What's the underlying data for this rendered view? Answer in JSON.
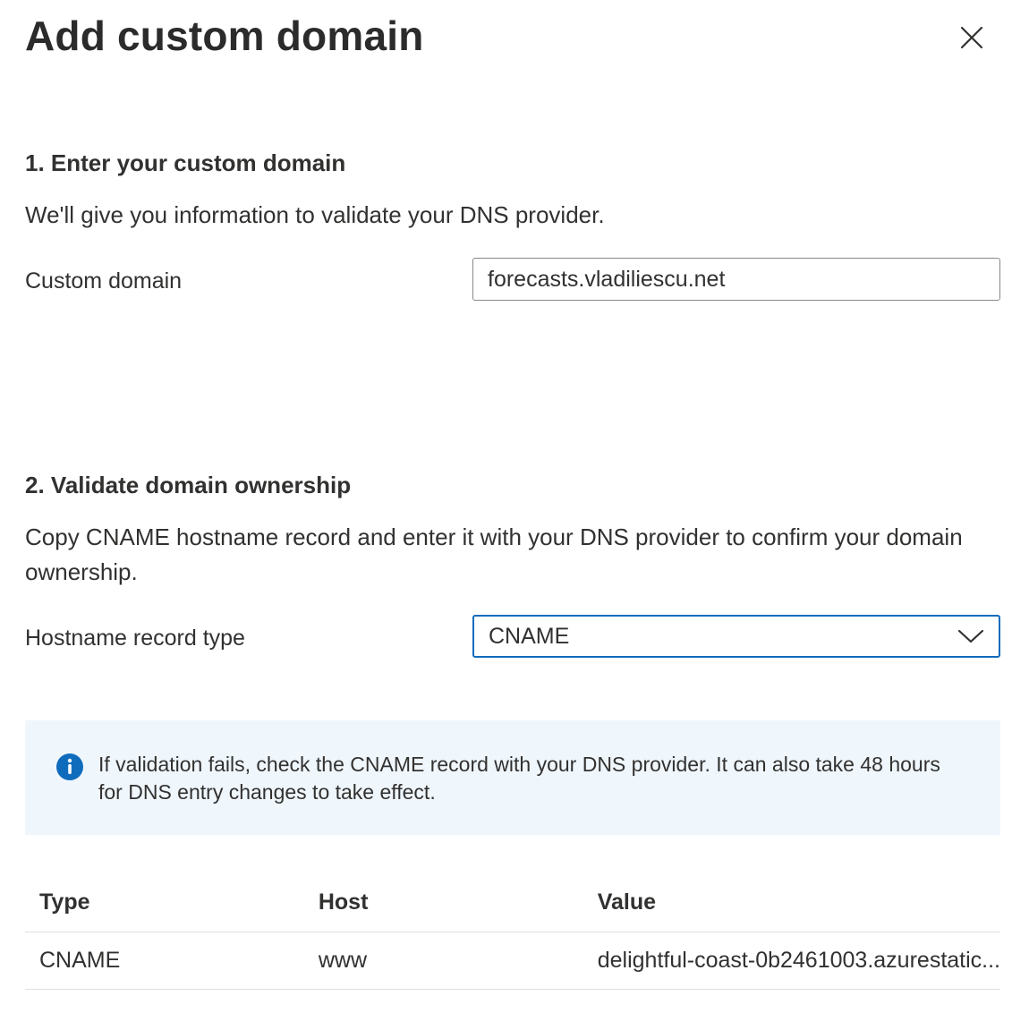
{
  "panel": {
    "title": "Add custom domain",
    "close_icon": "close-icon"
  },
  "step1": {
    "title": "1. Enter your custom domain",
    "description": "We'll give you information to validate your DNS provider.",
    "custom_domain_label": "Custom domain",
    "custom_domain_value": "forecasts.vladiliescu.net"
  },
  "step2": {
    "title": "2. Validate domain ownership",
    "description": "Copy CNAME hostname record and enter it with your DNS provider to confirm your domain ownership.",
    "record_type_label": "Hostname record type",
    "record_type_value": "CNAME",
    "dropdown_icon": "chevron-down-icon"
  },
  "info": {
    "icon": "info-icon",
    "message": "If validation fails, check the CNAME record with your DNS provider. It can also take 48 hours for DNS entry changes to take effect.",
    "accent": "#0f6cbd",
    "background": "#eff6fc"
  },
  "table": {
    "headers": {
      "type": "Type",
      "host": "Host",
      "value": "Value"
    },
    "rows": [
      {
        "type": "CNAME",
        "host": "www",
        "value": "delightful-coast-0b2461003.azurestatic..."
      }
    ]
  }
}
